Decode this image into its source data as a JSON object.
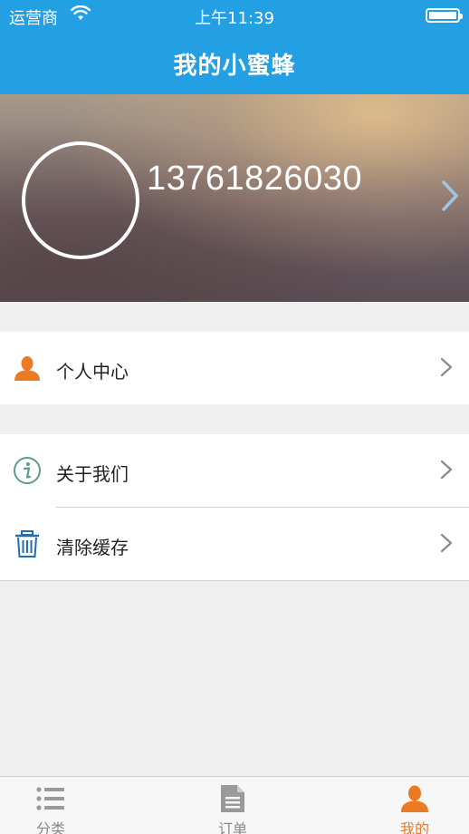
{
  "status_bar": {
    "carrier": "运营商",
    "time": "上午11:39"
  },
  "nav": {
    "title": "我的小蜜蜂"
  },
  "profile": {
    "phone": "13761826030"
  },
  "menu": {
    "personal_center": "个人中心",
    "about_us": "关于我们",
    "clear_cache": "清除缓存"
  },
  "tabs": [
    {
      "label": "分类"
    },
    {
      "label": "订单"
    },
    {
      "label": "我的"
    }
  ],
  "colors": {
    "primary": "#23a0e3",
    "accent": "#ea7b24",
    "icon_teal": "#5f9a8e",
    "icon_blue": "#1f6fb0"
  }
}
